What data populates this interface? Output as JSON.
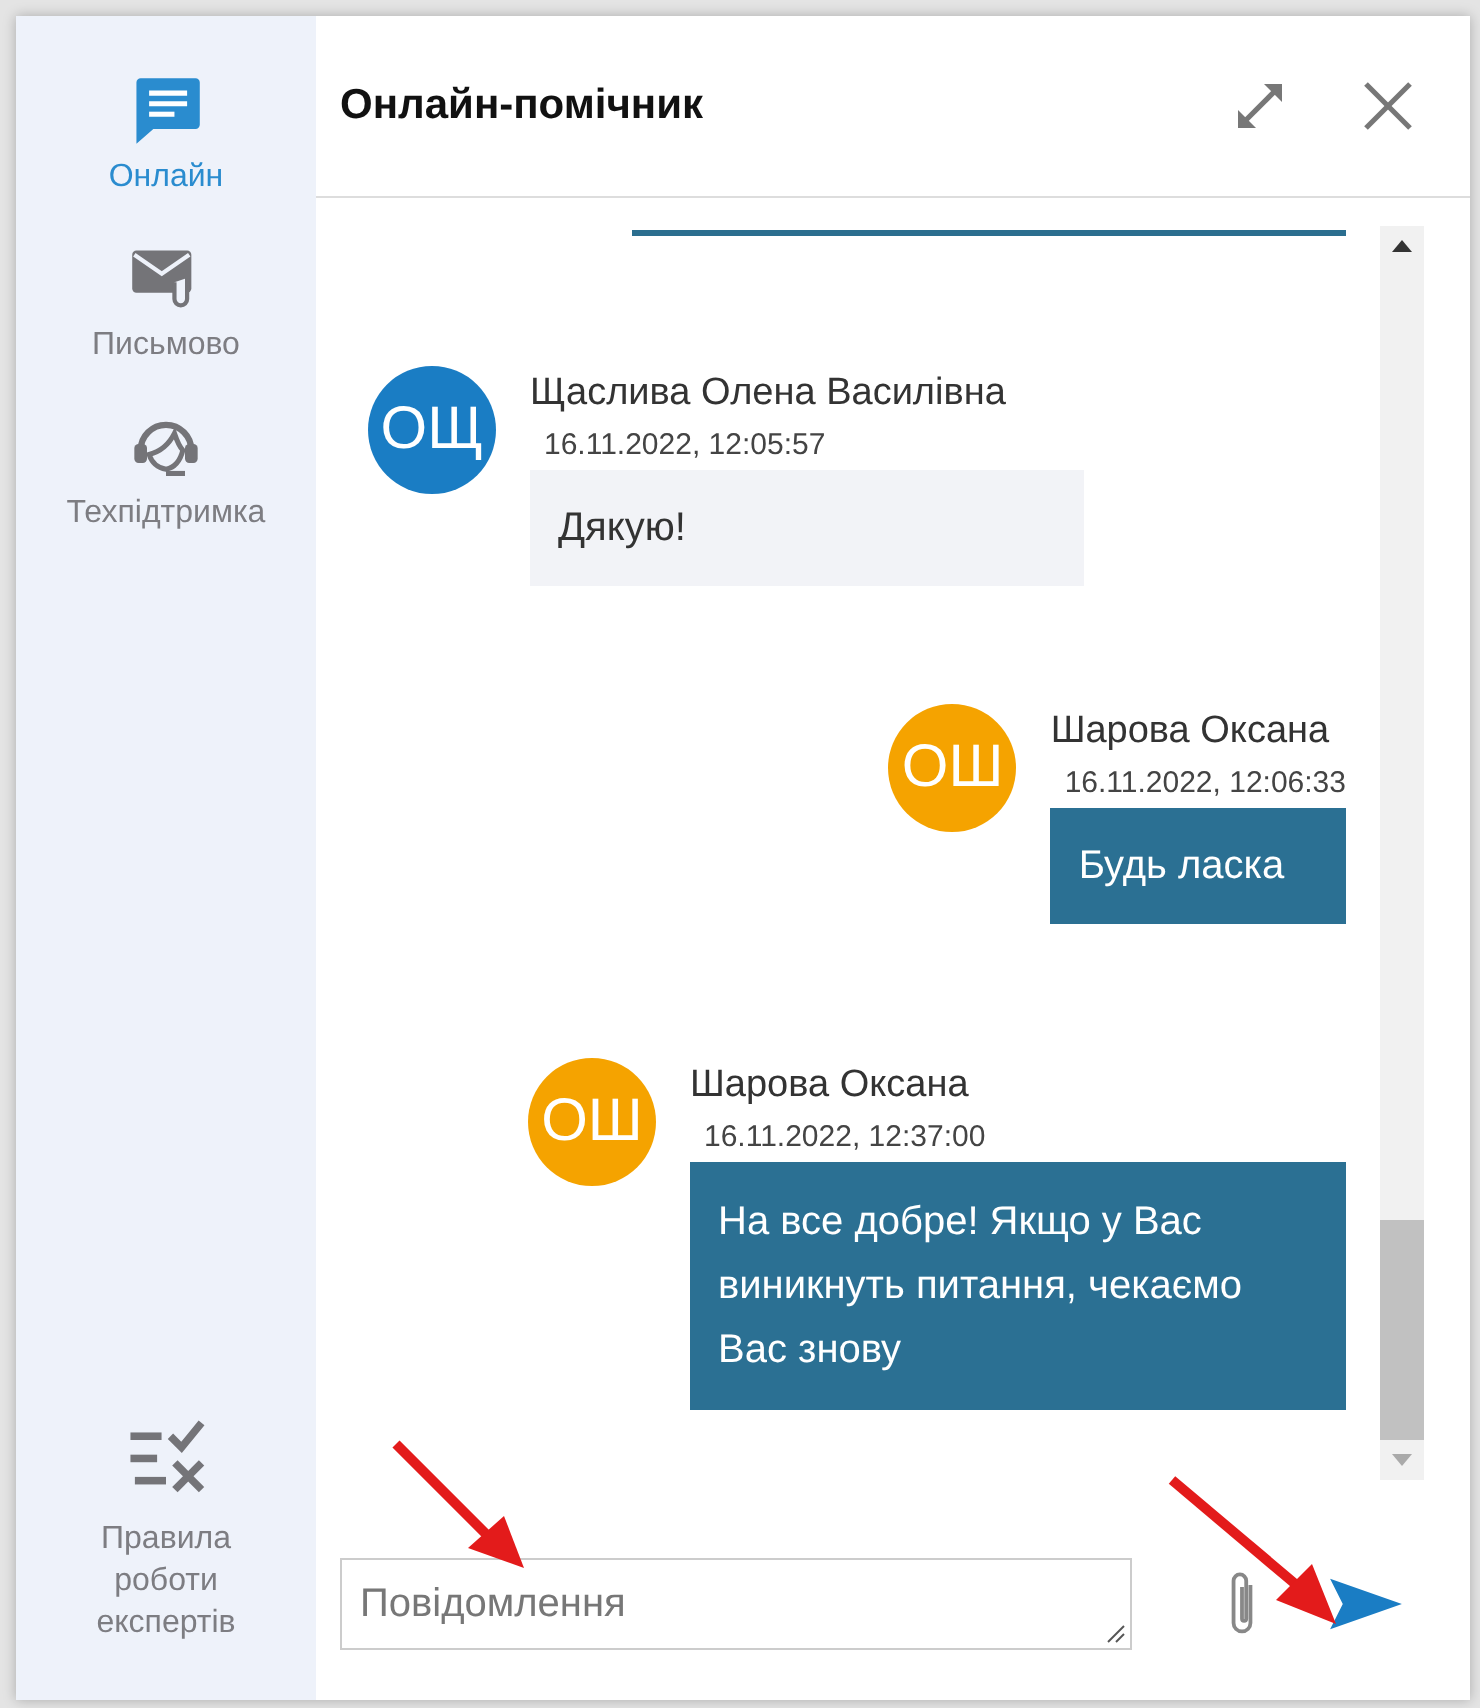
{
  "sidebar": {
    "items": [
      {
        "kind": "chat",
        "label": "Онлайн",
        "selected": true
      },
      {
        "kind": "mail",
        "label": "Письмово",
        "selected": false
      },
      {
        "kind": "support",
        "label": "Техпідтримка",
        "selected": false
      }
    ],
    "footer_item": {
      "kind": "rules",
      "label": "Правила роботи експертів"
    }
  },
  "header": {
    "title": "Онлайн-помічник"
  },
  "messages": [
    {
      "kind": "client",
      "initials": "ОЩ",
      "color": "#1a7dc4",
      "name": "Щаслива Олена Василівна",
      "time": "16.11.2022, 12:05:57",
      "text": "Дякую!"
    },
    {
      "kind": "operator",
      "initials": "ОШ",
      "color": "#f5a300",
      "name": "Шарова Оксана",
      "time": "16.11.2022, 12:06:33",
      "text": "Будь ласка"
    },
    {
      "kind": "operator",
      "initials": "ОШ",
      "color": "#f5a300",
      "name": "Шарова Оксана",
      "time": "16.11.2022, 12:37:00",
      "text": "На все добре! Якщо у Вас виникнуть питання, чекаємо Вас знову"
    }
  ],
  "composer": {
    "placeholder": "Повідомлення"
  }
}
